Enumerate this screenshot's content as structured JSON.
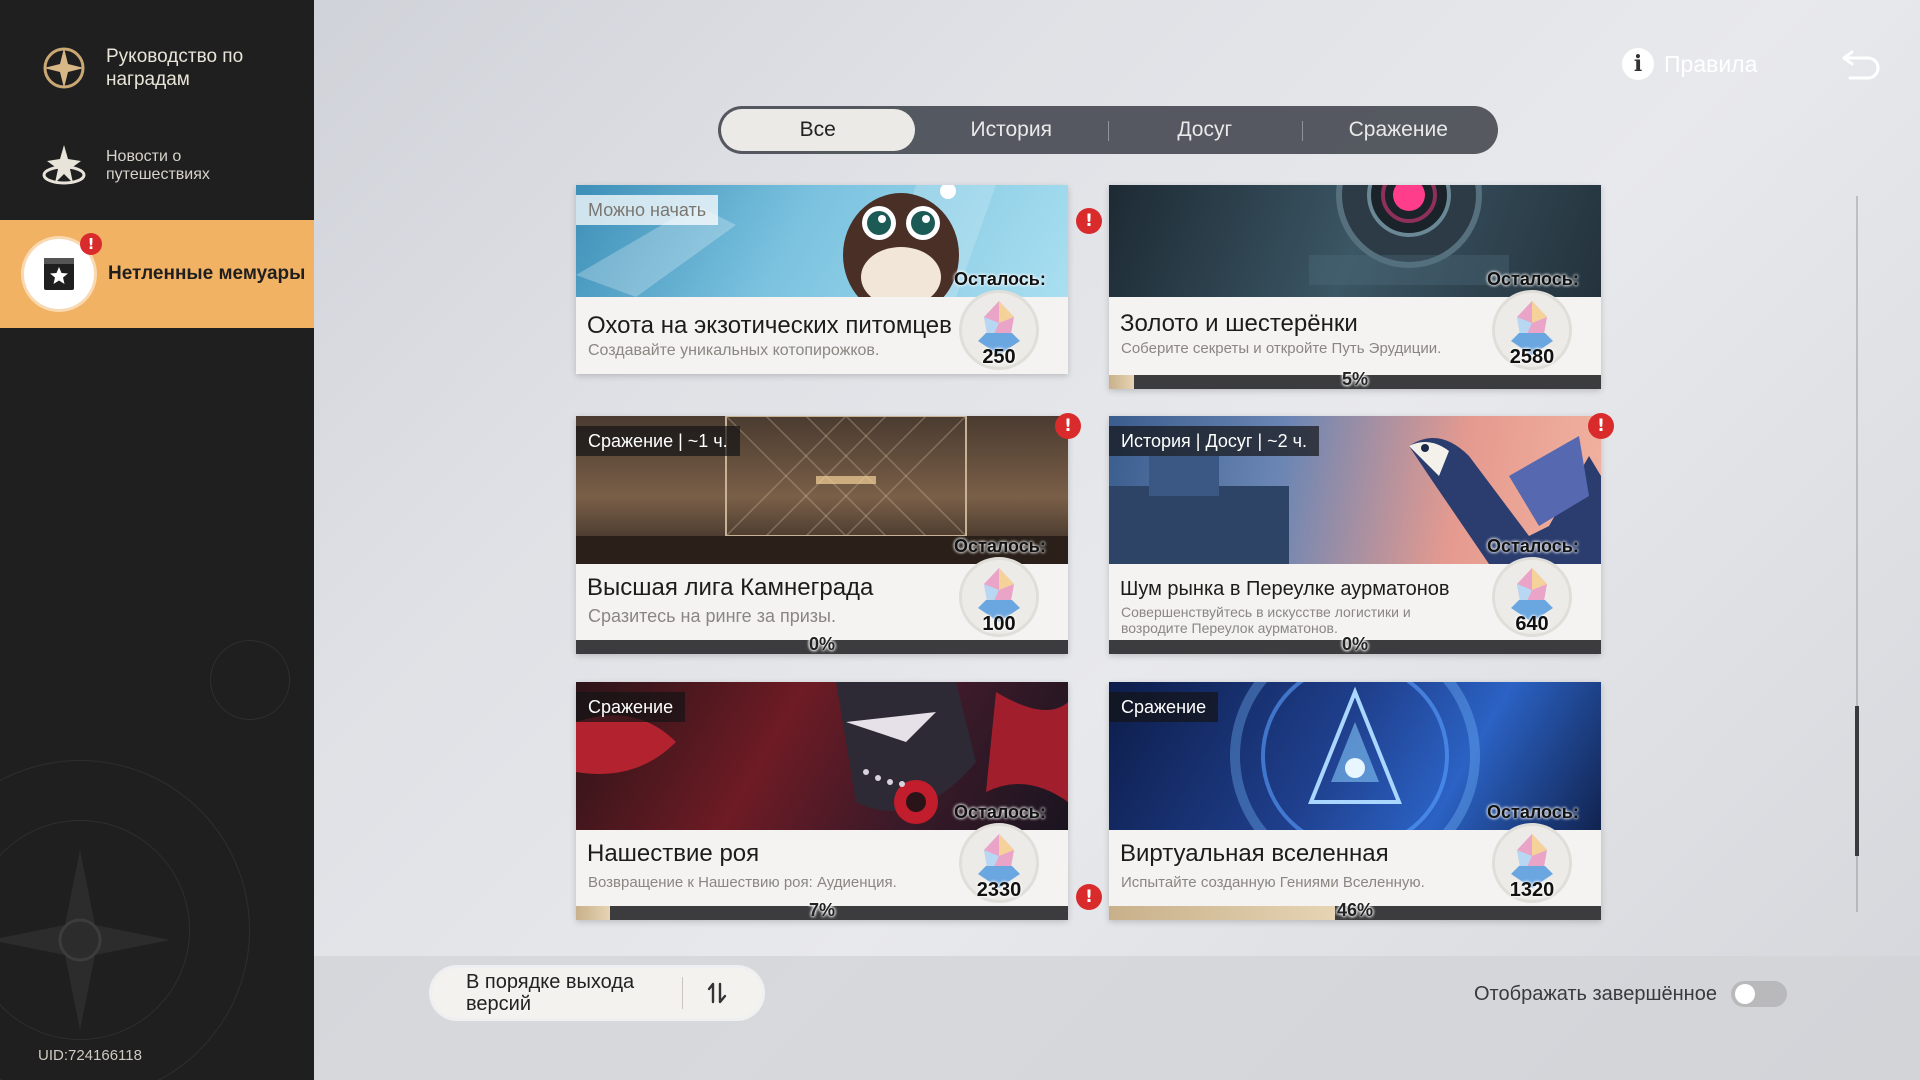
{
  "sidebar": {
    "items": [
      {
        "label": "Руководство по наградам",
        "icon": "compass-star-icon"
      },
      {
        "label": "Новости о путешествиях",
        "icon": "star-portal-icon"
      },
      {
        "label": "Нетленные мемуары",
        "icon": "memoir-book-icon",
        "active": true,
        "alert": "!"
      }
    ],
    "uid": "UID:724166118"
  },
  "header": {
    "rules_label": "Правила",
    "info_icon": "i"
  },
  "tabs": [
    {
      "label": "Все",
      "active": true
    },
    {
      "label": "История"
    },
    {
      "label": "Досуг"
    },
    {
      "label": "Сражение"
    }
  ],
  "cards": [
    {
      "tag": "Можно начать",
      "title": "Охота на экзотических питомцев",
      "desc": "Создавайте уникальных котопирожков.",
      "remaining_label": "Осталось:",
      "amount": "250",
      "progress": null,
      "alert": "!"
    },
    {
      "tag": "",
      "title": "Золото и шестерёнки",
      "desc": "Соберите секреты и откройте Путь Эрудиции.",
      "remaining_label": "Осталось:",
      "amount": "2580",
      "progress": 5,
      "progress_label": "5%"
    },
    {
      "tag": "Сражение | ~1 ч.",
      "title": "Высшая лига Камнеграда",
      "desc": "Сразитесь на ринге за призы.",
      "remaining_label": "Осталось:",
      "amount": "100",
      "progress": 0,
      "progress_label": "0%",
      "alert": "!"
    },
    {
      "tag": "История | Досуг | ~2 ч.",
      "title": "Шум рынка в Переулке аурматонов",
      "desc": "Совершенствуйтесь в искусстве логистики и возродите Переулок аурматонов.",
      "remaining_label": "Осталось:",
      "amount": "640",
      "progress": 0,
      "progress_label": "0%",
      "alert": "!"
    },
    {
      "tag": "Сражение",
      "title": "Нашествие роя",
      "desc": "Возвращение к Нашествию роя: Аудиенция.",
      "remaining_label": "Осталось:",
      "amount": "2330",
      "progress": 7,
      "progress_label": "7%",
      "alert": "!"
    },
    {
      "tag": "Сражение",
      "title": "Виртуальная вселенная",
      "desc": "Испытайте созданную Гениями Вселенную.",
      "remaining_label": "Осталось:",
      "amount": "1320",
      "progress": 46,
      "progress_label": "46%"
    }
  ],
  "footer": {
    "sort_label": "В порядке выхода версий",
    "show_completed_label": "Отображать завершённое",
    "show_completed": false
  },
  "colors": {
    "accent": "#f2b264",
    "alert": "#d92b2b",
    "sidebar_bg": "#1f1f1f",
    "progress_fill": "#d9c39e"
  }
}
